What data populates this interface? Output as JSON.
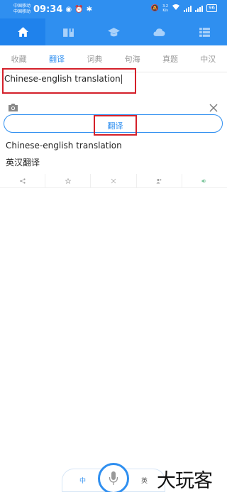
{
  "status_bar": {
    "carrier_1": "中国移动",
    "carrier_2": "中国移动",
    "time": "09:34",
    "net_speed_value": "3.2",
    "net_speed_unit": "K/s",
    "battery": "96"
  },
  "top_nav": {
    "tabs": [
      {
        "icon": "home-icon",
        "active": true
      },
      {
        "icon": "book-icon",
        "active": false
      },
      {
        "icon": "graduation-cap-icon",
        "active": false
      },
      {
        "icon": "cloud-icon",
        "active": false
      },
      {
        "icon": "grid-menu-icon",
        "active": false
      }
    ]
  },
  "sub_tabs": [
    {
      "label": "收藏",
      "active": false
    },
    {
      "label": "翻译",
      "active": true
    },
    {
      "label": "词典",
      "active": false
    },
    {
      "label": "句海",
      "active": false
    },
    {
      "label": "真题",
      "active": false
    },
    {
      "label": "中汉",
      "active": false
    }
  ],
  "input": {
    "value": "Chinese-english translation"
  },
  "translate_button": {
    "label": "翻译"
  },
  "result": {
    "source": "Chinese-english translation",
    "translation": "英汉翻译"
  },
  "actions": [
    "share-icon",
    "star-icon",
    "clear-icon",
    "add-user-icon",
    "speaker-icon"
  ],
  "lang_bar": {
    "left": "中",
    "right": "英"
  },
  "watermark": "大玩客",
  "colors": {
    "accent": "#2f8ff0",
    "highlight": "#d4202a"
  }
}
